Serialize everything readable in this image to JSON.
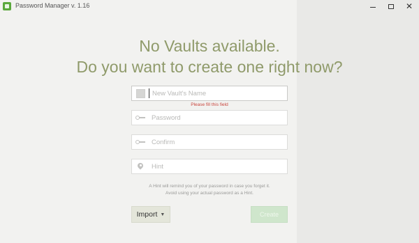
{
  "window": {
    "title": "Password Manager v. 1.16",
    "controls": {
      "minimize": "minimize",
      "maximize": "maximize",
      "close": "close"
    }
  },
  "headline": {
    "line1": "No Vaults available.",
    "line2": "Do you want to create one right now?"
  },
  "form": {
    "vault_name": {
      "placeholder": "New Vault's Name",
      "value": "",
      "error": "Please fill this field"
    },
    "password": {
      "placeholder": "Password",
      "value": ""
    },
    "confirm": {
      "placeholder": "Confirm",
      "value": ""
    },
    "hint": {
      "placeholder": "Hint",
      "value": ""
    }
  },
  "note": {
    "line1": "A Hint will remind you of your password in case you forget it.",
    "line2": "Avoid using your actual password as a Hint."
  },
  "buttons": {
    "import_label": "Import",
    "create_label": "Create"
  },
  "colors": {
    "headline": "#8f9a6a",
    "app_icon": "#5aa83c",
    "error": "#c9463d",
    "create_button": "#cfe6cc",
    "import_button": "#e4e6da"
  },
  "icons": {
    "app": "app-logo-icon",
    "vault": "vault-square-icon",
    "password": "key-icon",
    "confirm": "key-icon",
    "hint": "map-pin-icon"
  }
}
